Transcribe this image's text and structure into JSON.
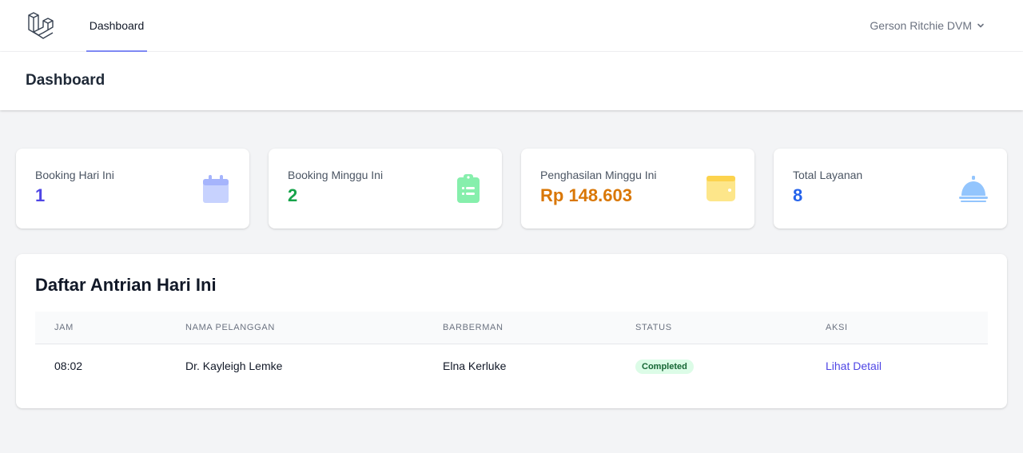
{
  "nav": {
    "dashboard_link": "Dashboard",
    "user_name": "Gerson Ritchie DVM",
    "logo_icon": "laravel-logo-icon",
    "chevron_icon": "chevron-down-icon"
  },
  "header": {
    "title": "Dashboard"
  },
  "stats": [
    {
      "label": "Booking Hari Ini",
      "value": "1",
      "color": "#4f46e5",
      "icon": "calendar-icon",
      "icon_color": "#c7d2fe"
    },
    {
      "label": "Booking Minggu Ini",
      "value": "2",
      "color": "#16a34a",
      "icon": "clipboard-list-icon",
      "icon_color": "#86efac"
    },
    {
      "label": "Penghasilan Minggu Ini",
      "value": "Rp 148.603",
      "color": "#d97706",
      "icon": "wallet-icon",
      "icon_color": "#fde68a"
    },
    {
      "label": "Total Layanan",
      "value": "8",
      "color": "#2563eb",
      "icon": "service-bell-icon",
      "icon_color": "#93c5fd"
    }
  ],
  "queue": {
    "title": "Daftar Antrian Hari Ini",
    "columns": [
      "JAM",
      "NAMA PELANGGAN",
      "BARBERMAN",
      "STATUS",
      "AKSI"
    ],
    "rows": [
      {
        "time": "08:02",
        "customer": "Dr. Kayleigh Lemke",
        "barber": "Elna Kerluke",
        "status": "Completed",
        "action": "Lihat Detail"
      }
    ]
  }
}
